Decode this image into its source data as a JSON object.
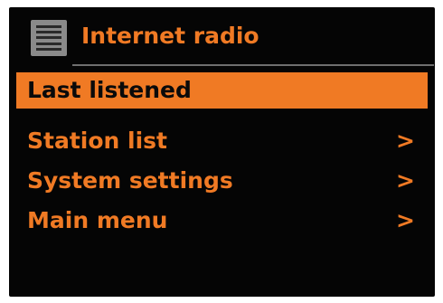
{
  "header": {
    "title": "Internet radio",
    "icon": "menu-list-icon"
  },
  "menu": {
    "items": [
      {
        "label": "Last listened",
        "arrow": "",
        "selected": true
      },
      {
        "label": "Station list",
        "arrow": ">",
        "selected": false
      },
      {
        "label": "System settings",
        "arrow": ">",
        "selected": false
      },
      {
        "label": "Main menu",
        "arrow": ">",
        "selected": false
      }
    ]
  },
  "colors": {
    "accent": "#f07a24",
    "background": "#050505",
    "divider": "#6f6f6f",
    "icon": "#8a8a8a"
  }
}
